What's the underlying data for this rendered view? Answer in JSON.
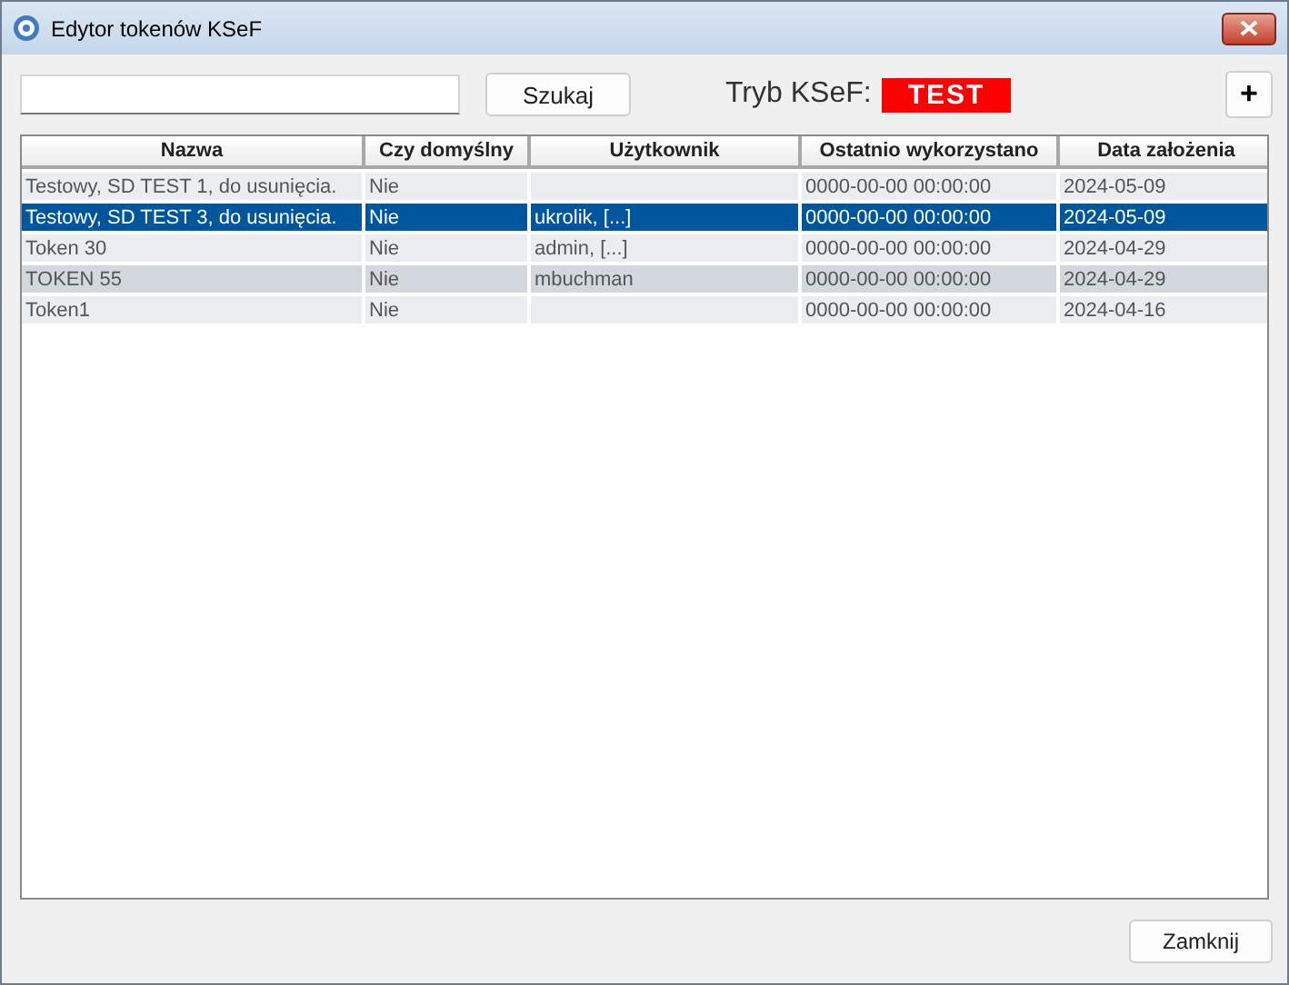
{
  "window": {
    "title": "Edytor tokenów KSeF"
  },
  "toolbar": {
    "search_button": "Szukaj",
    "mode_label": "Tryb KSeF:",
    "mode_value": "TEST",
    "add_button": "+"
  },
  "table": {
    "columns": [
      "Nazwa",
      "Czy domyślny",
      "Użytkownik",
      "Ostatnio wykorzystano",
      "Data założenia"
    ],
    "rows": [
      {
        "cells": [
          "Testowy, SD TEST 1, do usunięcia.",
          "Nie",
          "",
          "0000-00-00 00:00:00",
          "2024-05-09"
        ],
        "selected": false,
        "hovered": false
      },
      {
        "cells": [
          "Testowy, SD TEST 3, do usunięcia.",
          "Nie",
          "ukrolik, [...]",
          "0000-00-00 00:00:00",
          "2024-05-09"
        ],
        "selected": true,
        "hovered": false
      },
      {
        "cells": [
          "Token 30",
          "Nie",
          "admin, [...]",
          "0000-00-00 00:00:00",
          "2024-04-29"
        ],
        "selected": false,
        "hovered": false
      },
      {
        "cells": [
          "TOKEN 55",
          "Nie",
          "mbuchman",
          "0000-00-00 00:00:00",
          "2024-04-29"
        ],
        "selected": false,
        "hovered": true
      },
      {
        "cells": [
          "Token1",
          "Nie",
          "",
          "0000-00-00 00:00:00",
          "2024-04-16"
        ],
        "selected": false,
        "hovered": false
      }
    ]
  },
  "close_button": "Zamknij"
}
